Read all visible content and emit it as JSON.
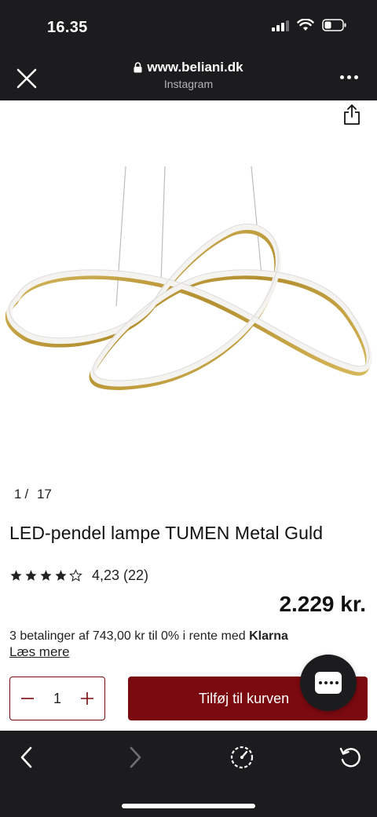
{
  "status_bar": {
    "time": "16.35"
  },
  "browser": {
    "url": "www.beliani.dk",
    "source": "Instagram"
  },
  "gallery": {
    "current": "1",
    "separator": "/",
    "total": "17"
  },
  "product": {
    "title": "LED-pendel lampe TUMEN Metal Guld",
    "rating_value": 4.23,
    "rating_text": "4,23 (22)",
    "stars_filled": 4,
    "stars_total": 5,
    "price": "2.229 kr."
  },
  "financing": {
    "text": "3 betalinger af 743,00 kr til 0% i rente med ",
    "provider": "Klarna",
    "read_more": "Læs mere"
  },
  "cart": {
    "quantity": "1",
    "add_label": "Tilføj til kurven"
  },
  "colors": {
    "brand": "#7b0a10",
    "chrome": "#1c1c1e",
    "gold": "#c8a84a"
  }
}
